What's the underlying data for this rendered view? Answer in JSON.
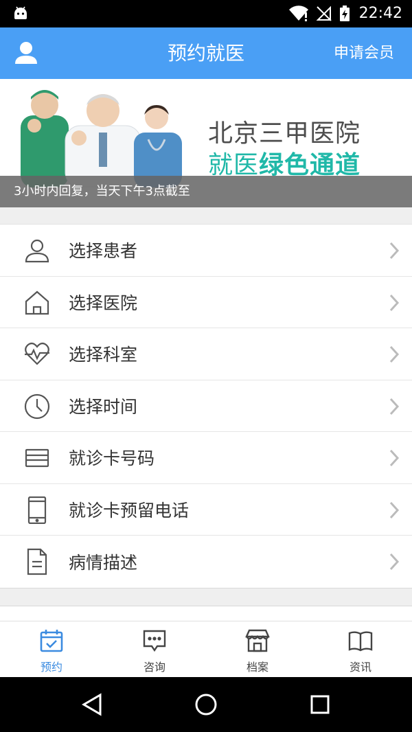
{
  "status_bar": {
    "time": "22:42"
  },
  "app_bar": {
    "title": "预约就医",
    "action_label": "申请会员"
  },
  "banner": {
    "line1": "北京三甲医院",
    "line2_a": "就医",
    "line2_b": "绿色通道",
    "caption": "3小时内回复，当天下午3点截至"
  },
  "menu": {
    "items": [
      {
        "label": "选择患者",
        "icon": "person-icon"
      },
      {
        "label": "选择医院",
        "icon": "home-icon"
      },
      {
        "label": "选择科室",
        "icon": "heartbeat-icon"
      },
      {
        "label": "选择时间",
        "icon": "clock-icon"
      },
      {
        "label": "就诊卡号码",
        "icon": "card-icon"
      },
      {
        "label": "就诊卡预留电话",
        "icon": "phone-icon"
      },
      {
        "label": "病情描述",
        "icon": "document-icon"
      }
    ]
  },
  "tabs": [
    {
      "label": "预约",
      "icon": "calendar-check-icon",
      "active": true
    },
    {
      "label": "咨询",
      "icon": "chat-icon",
      "active": false
    },
    {
      "label": "档案",
      "icon": "store-icon",
      "active": false
    },
    {
      "label": "资讯",
      "icon": "book-icon",
      "active": false
    }
  ],
  "colors": {
    "primary": "#4a9ff5",
    "accent_green": "#20b8a8",
    "tab_active": "#3b8be0"
  }
}
